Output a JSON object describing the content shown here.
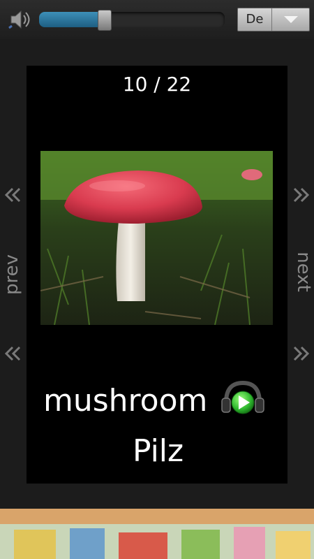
{
  "volume": {
    "level_fraction": 0.35
  },
  "language_selector": {
    "selected": "De"
  },
  "card": {
    "counter": "10 / 22",
    "word": "mushroom",
    "translation": "Pilz"
  },
  "navigation": {
    "prev_label": "prev",
    "next_label": "next"
  },
  "icons": {
    "speaker": "speaker-icon",
    "dropdown": "chevron-down-icon",
    "play": "headphones-play-icon",
    "prev": "double-chevron-left-icon",
    "next": "double-chevron-right-icon"
  },
  "colors": {
    "background": "#1c1c1c",
    "card": "#000000",
    "volume_fill": "#2f7aa3",
    "play_green": "#3cc93c",
    "nav_gray": "#8a8a8a"
  }
}
